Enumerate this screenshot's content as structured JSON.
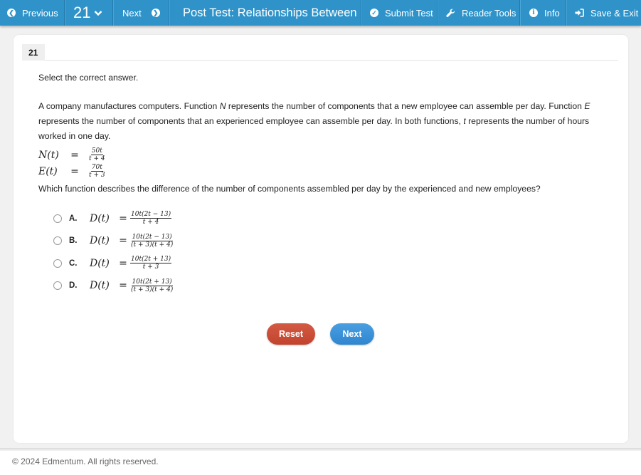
{
  "topbar": {
    "previous_label": "Previous",
    "question_number": "21",
    "next_label": "Next",
    "title": "Post Test: Relationships Between F",
    "submit_label": "Submit Test",
    "reader_tools_label": "Reader Tools",
    "info_label": "Info",
    "save_exit_label": "Save & Exit",
    "icons": {
      "previous": "chevron-left-circle-icon",
      "dropdown": "chevron-down-icon",
      "next": "chevron-right-circle-icon",
      "submit": "check-circle-icon",
      "reader_tools": "wrench-icon",
      "info": "info-circle-icon",
      "save_exit": "sign-in-icon"
    }
  },
  "question": {
    "number": "21",
    "instruction": "Select the correct answer.",
    "stem_parts": {
      "p1": "A company manufactures computers. Function ",
      "var_n": "N",
      "p2": " represents the number of components that a new employee can assemble per day. Function ",
      "var_e": "E",
      "p3": " represents the number of components that an experienced employee can assemble per day. In both functions, ",
      "var_t": "t",
      "p4": " represents the number of hours worked in one day."
    },
    "equations": [
      {
        "lhs": "N(t)",
        "eq": "=",
        "num": "50t",
        "den": "t + 4"
      },
      {
        "lhs": "E(t)",
        "eq": "=",
        "num": "70t",
        "den": "t + 3"
      }
    ],
    "prompt": "Which function describes the difference of the number of components assembled per day by the experienced and new employees?",
    "options": [
      {
        "letter": "A.",
        "lhs": "D(t)",
        "eq": "=",
        "num": "10t(2t − 13)",
        "den": "t + 4"
      },
      {
        "letter": "B.",
        "lhs": "D(t)",
        "eq": "=",
        "num": "10t(2t − 13)",
        "den": "(t + 3)(t + 4)"
      },
      {
        "letter": "C.",
        "lhs": "D(t)",
        "eq": "=",
        "num": "10t(2t + 13)",
        "den": "t + 3"
      },
      {
        "letter": "D.",
        "lhs": "D(t)",
        "eq": "=",
        "num": "10t(2t + 13)",
        "den": "(t + 3)(t + 4)"
      }
    ]
  },
  "buttons": {
    "reset_label": "Reset",
    "next_label": "Next"
  },
  "colors": {
    "topbar": "#2f93c9",
    "reset": "#c94c36",
    "next": "#3a8fd8"
  },
  "footer": {
    "copyright": "© 2024 Edmentum. All rights reserved."
  }
}
